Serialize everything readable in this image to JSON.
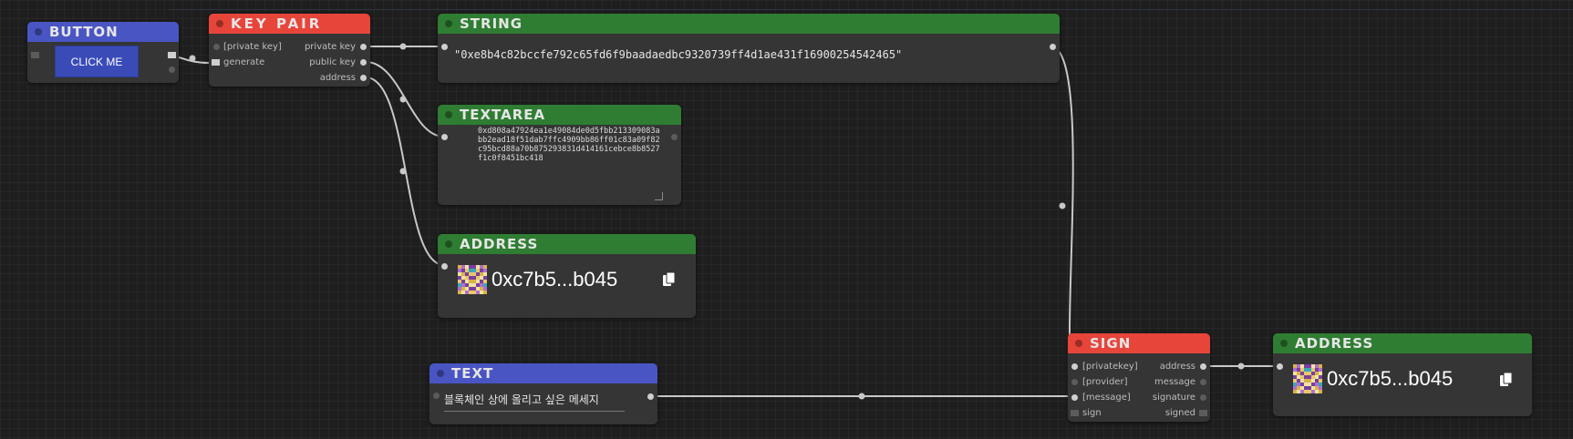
{
  "nodes": {
    "button": {
      "title": "BUTTON",
      "button_label": "CLICK ME"
    },
    "key_pair": {
      "title": "KEY PAIR",
      "inputs": [
        "[private key]",
        "generate"
      ],
      "outputs": [
        "private key",
        "public key",
        "address"
      ]
    },
    "string": {
      "title": "STRING",
      "value": "\"0xe8b4c82bccfe792c65fd6f9baadaedbc9320739ff4d1ae431f16900254542465\""
    },
    "textarea": {
      "title": "TEXTAREA",
      "value": "0xd808a47924ea1e49084de0d5fbb213309083abb2ead18f51dab7ffc4909bb86ff01c83a09f82c95bcd88a70b875293831d414161cebce8b8527f1c0f8451bc418"
    },
    "address1": {
      "title": "ADDRESS",
      "value": "0xc7b5...b045"
    },
    "text": {
      "title": "TEXT",
      "value": "블록체인 상에 올리고 싶은 메세지"
    },
    "sign": {
      "title": "SIGN",
      "inputs": [
        "[privatekey]",
        "[provider]",
        "[message]",
        "sign"
      ],
      "outputs": [
        "address",
        "message",
        "signature",
        "signed"
      ]
    },
    "address2": {
      "title": "ADDRESS",
      "value": "0xc7b5...b045"
    }
  },
  "icons": {
    "copy": "copy-icon",
    "identicon": "blockie-identicon"
  },
  "colors": {
    "header_red": "#e8453a",
    "header_blue": "#4a55c4",
    "header_green": "#2f7d32",
    "node_body": "#353535",
    "canvas": "#1e1e1e",
    "wire": "#c8c8c8"
  }
}
